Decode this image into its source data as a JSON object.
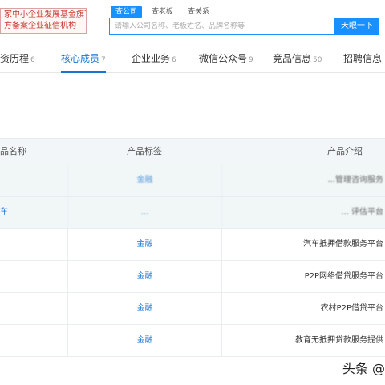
{
  "header": {
    "promo_line1": "家中小企业发展基金旗下",
    "promo_line2": "方备案企业征信机构",
    "search_tabs": [
      {
        "label": "查公司",
        "active": true
      },
      {
        "label": "查老板",
        "active": false
      },
      {
        "label": "查关系",
        "active": false
      }
    ],
    "search_placeholder": "请输入公司名称、老板姓名、品牌名称等",
    "search_button": "天眼一下"
  },
  "nav": {
    "tabs": [
      {
        "label": "资历程",
        "count": "6",
        "active": false
      },
      {
        "label": "核心成员",
        "count": "7",
        "active": true
      },
      {
        "label": "企业业务",
        "count": "6",
        "active": false
      },
      {
        "label": "微信公众号",
        "count": "9",
        "active": false
      },
      {
        "label": "竞品信息",
        "count": "50",
        "active": false
      },
      {
        "label": "招聘信息",
        "count": "",
        "active": false
      }
    ]
  },
  "table": {
    "headers": [
      "品名称",
      "产品标签",
      "产品介绍"
    ],
    "rows": [
      {
        "name": "",
        "tag": "金融",
        "intro": "...管理咨询服务",
        "shade": true,
        "blurred": true
      },
      {
        "name": "车",
        "tag": "...",
        "intro": "... 评估平台",
        "shade": true,
        "blurred": true
      },
      {
        "name": "",
        "tag": "金融",
        "intro": "汽车抵押借款服务平台",
        "shade": false,
        "blurred": false
      },
      {
        "name": "",
        "tag": "金融",
        "intro": "P2P网络借贷服务平台",
        "shade": false,
        "blurred": false
      },
      {
        "name": "",
        "tag": "金融",
        "intro": "农村P2P借贷平台",
        "shade": false,
        "blurred": false
      },
      {
        "name": "",
        "tag": "金融",
        "intro": "教育无抵押贷款服务提供",
        "shade": false,
        "blurred": false
      }
    ]
  },
  "watermark": "头条 @"
}
